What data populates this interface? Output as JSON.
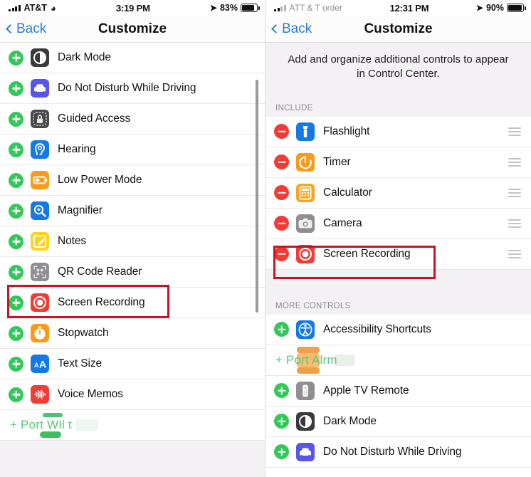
{
  "left": {
    "status": {
      "carrier": "AT&T",
      "wifi_icon": "wifi-icon",
      "time": "3:19 PM",
      "location_icon": "location-arrow-icon",
      "battery_pct": "83%",
      "battery_level": 83
    },
    "nav": {
      "back_label": "Back",
      "title": "Customize"
    },
    "rows": [
      {
        "action": "add",
        "icon": "dark-mode-icon",
        "label": "Dark Mode"
      },
      {
        "action": "add",
        "icon": "do-not-disturb-driving-icon",
        "label": "Do Not Disturb While Driving"
      },
      {
        "action": "add",
        "icon": "guided-access-icon",
        "label": "Guided Access"
      },
      {
        "action": "add",
        "icon": "hearing-icon",
        "label": "Hearing"
      },
      {
        "action": "add",
        "icon": "low-power-mode-icon",
        "label": "Low Power Mode"
      },
      {
        "action": "add",
        "icon": "magnifier-icon",
        "label": "Magnifier"
      },
      {
        "action": "add",
        "icon": "notes-icon",
        "label": "Notes"
      },
      {
        "action": "add",
        "icon": "qr-code-reader-icon",
        "label": "QR Code Reader"
      },
      {
        "action": "add",
        "icon": "screen-recording-icon",
        "label": "Screen Recording",
        "highlighted": true
      },
      {
        "action": "add",
        "icon": "stopwatch-icon",
        "label": "Stopwatch"
      },
      {
        "action": "add",
        "icon": "text-size-icon",
        "label": "Text Size"
      },
      {
        "action": "add",
        "icon": "voice-memos-icon",
        "label": "Voice Memos"
      }
    ],
    "artifact": {
      "text": "+ Port WIl t"
    }
  },
  "right": {
    "status": {
      "carrier": "ATT & T order",
      "time": "12:31 PM",
      "location_icon": "location-arrow-icon",
      "battery_pct": "90%",
      "battery_level": 90
    },
    "nav": {
      "back_label": "Back",
      "title": "Customize"
    },
    "blurb": "Add and organize additional controls to appear in Control Center.",
    "section_include": "INCLUDE",
    "include_rows": [
      {
        "action": "remove",
        "icon": "flashlight-icon",
        "label": "Flashlight",
        "handle": "reorder-handle"
      },
      {
        "action": "remove",
        "icon": "timer-icon",
        "label": "Timer",
        "handle": "reorder-handle"
      },
      {
        "action": "remove",
        "icon": "calculator-icon",
        "label": "Calculator",
        "handle": "reorder-handle"
      },
      {
        "action": "remove",
        "icon": "camera-icon",
        "label": "Camera",
        "handle": "reorder-handle"
      },
      {
        "action": "remove",
        "icon": "screen-recording-icon",
        "label": "Screen Recording",
        "handle": "reorder-handle",
        "highlighted": true
      }
    ],
    "section_more": "MORE CONTROLS",
    "more_rows": [
      {
        "action": "add",
        "icon": "accessibility-shortcuts-icon",
        "label": "Accessibility Shortcuts"
      },
      {
        "action": "artifact",
        "icon": "alarm-icon",
        "label": "+ Port Alrm"
      },
      {
        "action": "add",
        "icon": "apple-tv-remote-icon",
        "label": "Apple TV Remote"
      },
      {
        "action": "add",
        "icon": "dark-mode-icon",
        "label": "Dark Mode"
      },
      {
        "action": "add",
        "icon": "do-not-disturb-driving-icon",
        "label": "Do Not Disturb While Driving"
      }
    ]
  },
  "colors": {
    "add_green": "#34c759",
    "remove_red": "#f23b34",
    "highlight_red": "#cc1122",
    "link_blue": "#2b7bd6",
    "group_bg": "#f3f1f4"
  }
}
